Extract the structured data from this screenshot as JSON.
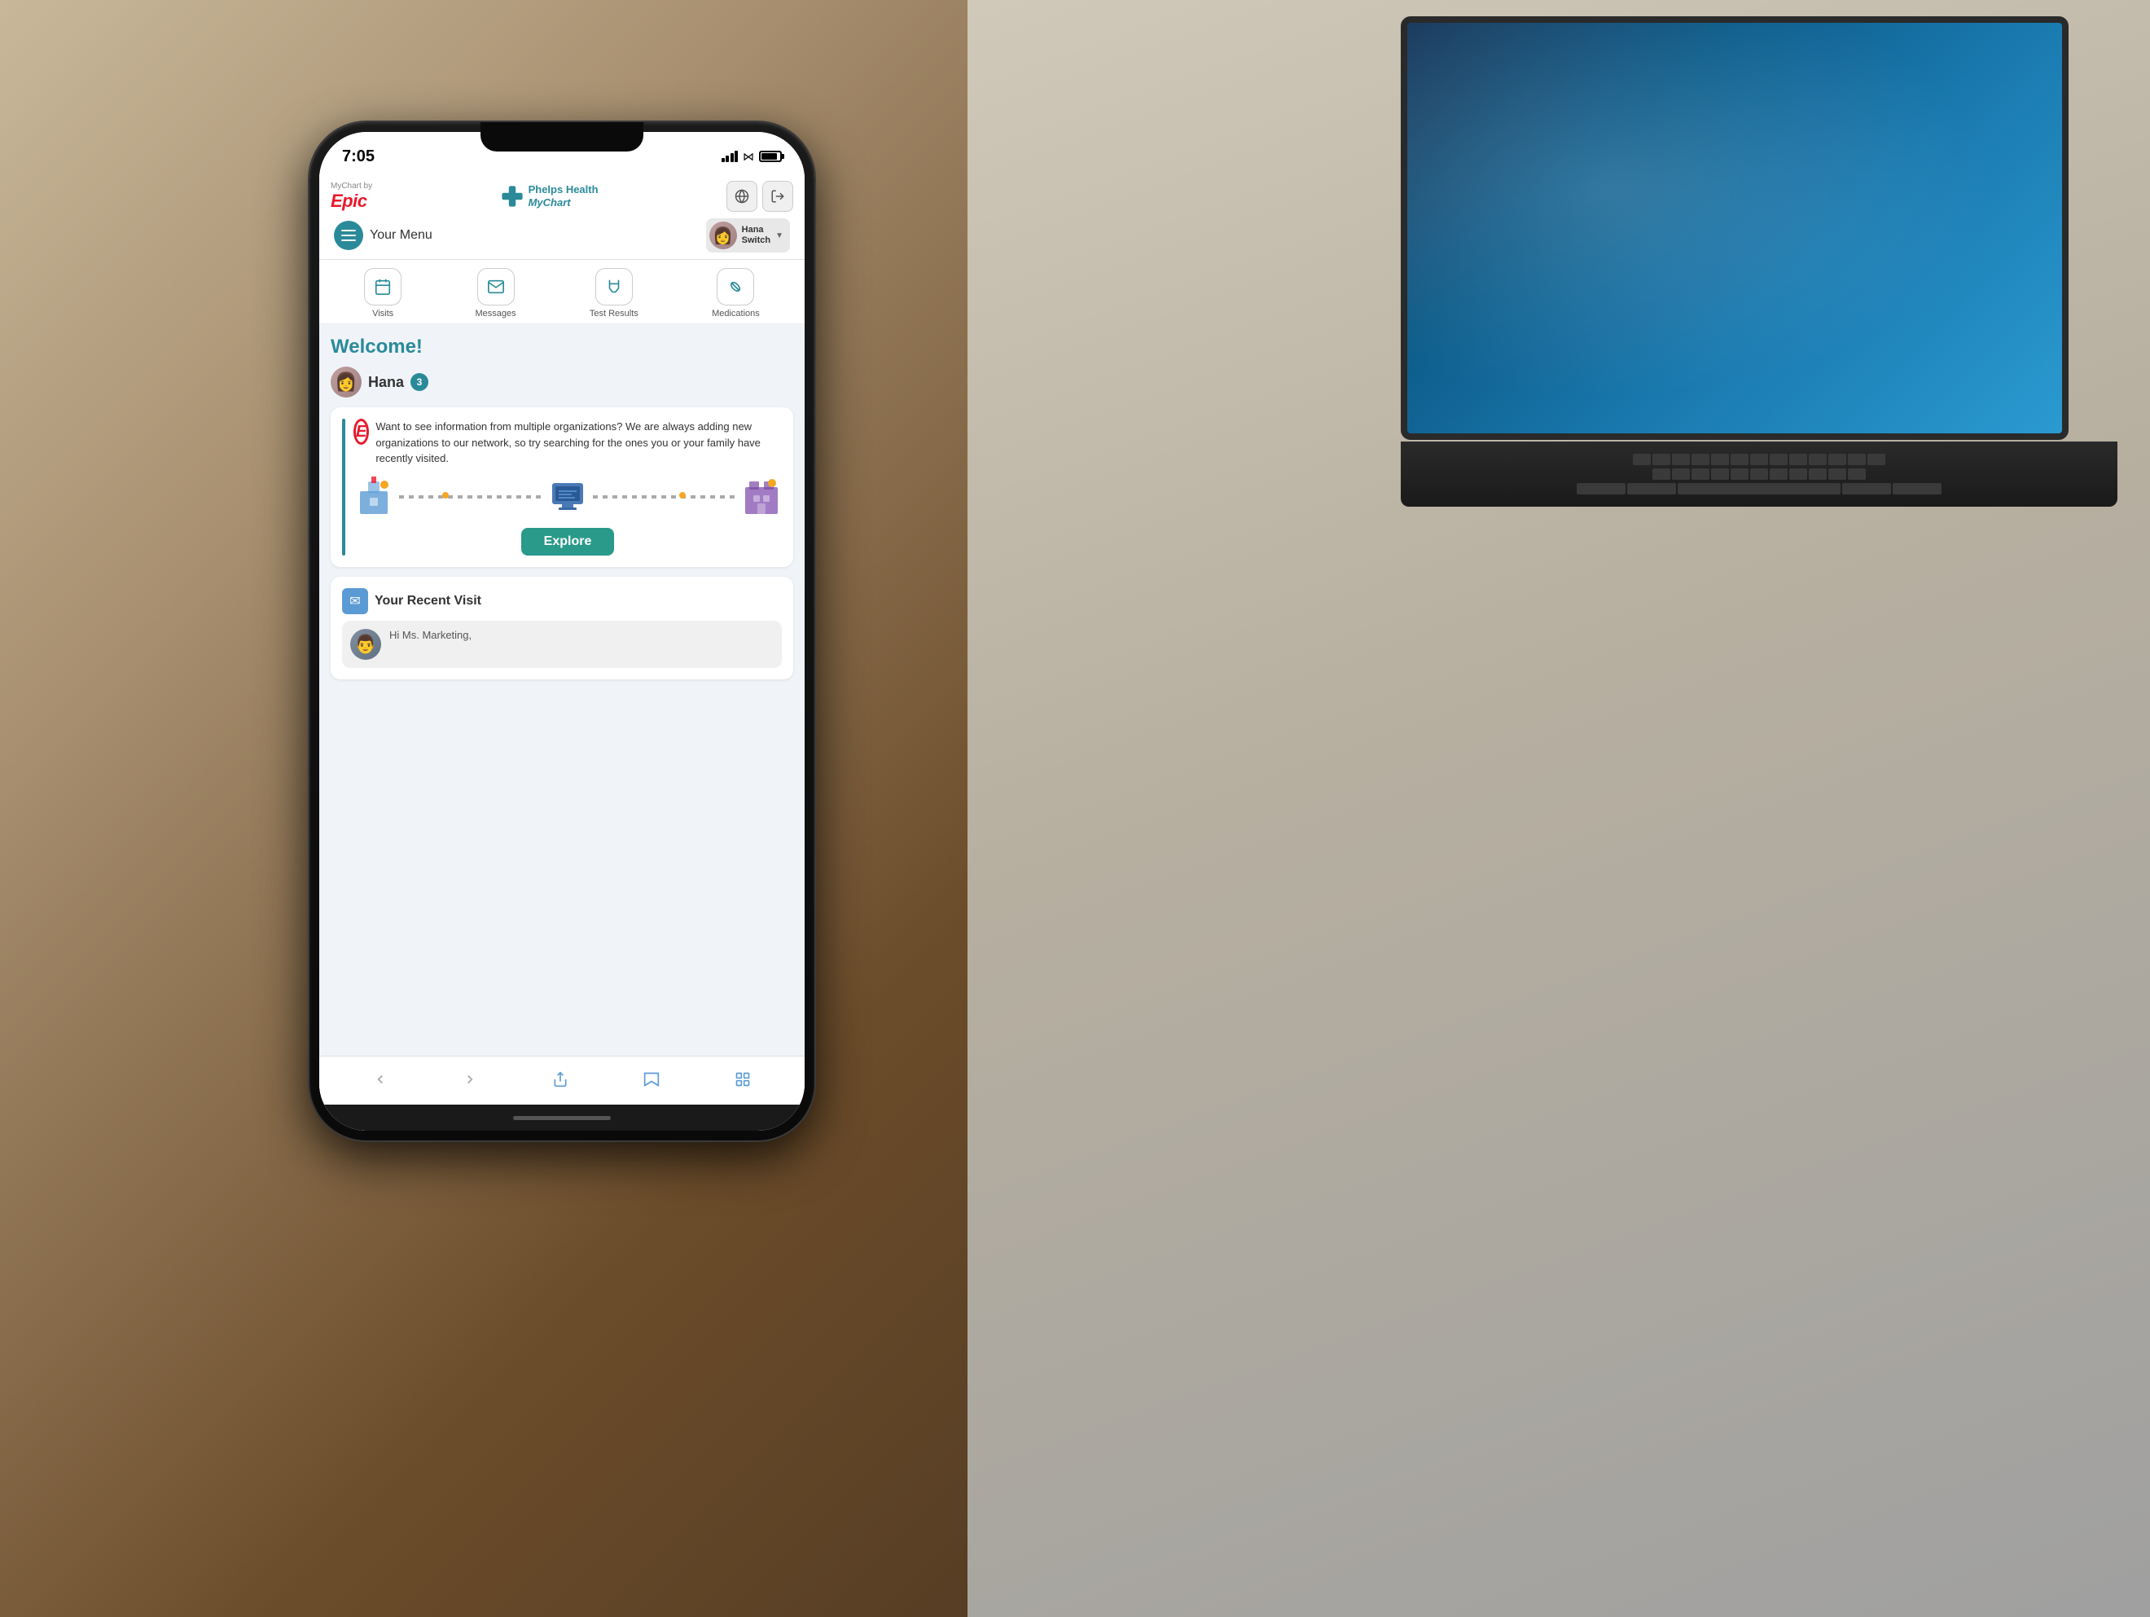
{
  "background": {
    "color": "#6b4c2a"
  },
  "status_bar": {
    "time": "7:05",
    "location_arrow": "▶"
  },
  "header": {
    "mychart_by": "MyChart by",
    "epic_label": "Epic",
    "phelps_name": "Phelps Health",
    "mychart_branded": "MyChart",
    "globe_icon": "🌐",
    "logout_icon": "↪",
    "menu_label": "Your Menu",
    "user_name": "Hana Switch",
    "user_name_short": "Hana\nSwitch"
  },
  "quick_actions": [
    {
      "label": "Visits",
      "icon": "📅"
    },
    {
      "label": "Messages",
      "icon": "✉️"
    },
    {
      "label": "Test Results",
      "icon": "🧪"
    },
    {
      "label": "Medications",
      "icon": "💊"
    }
  ],
  "main": {
    "welcome": "Welcome!",
    "user_first_name": "Hana",
    "notification_count": "3",
    "org_card": {
      "text": "Want to see information from multiple organizations? We are always adding new organizations to our network, so try searching for the ones you or your family have recently visited.",
      "explore_btn": "Explore"
    },
    "recent_visit": {
      "title": "Your Recent Visit",
      "preview_text": "Hi Ms. Marketing,"
    }
  },
  "bottom_nav": [
    {
      "icon": "‹",
      "label": "back",
      "active": false
    },
    {
      "icon": "›",
      "label": "forward",
      "active": false
    },
    {
      "icon": "⬆",
      "label": "share",
      "active": true
    },
    {
      "icon": "📖",
      "label": "reading-list",
      "active": true
    },
    {
      "icon": "⧉",
      "label": "tabs",
      "active": true
    }
  ]
}
